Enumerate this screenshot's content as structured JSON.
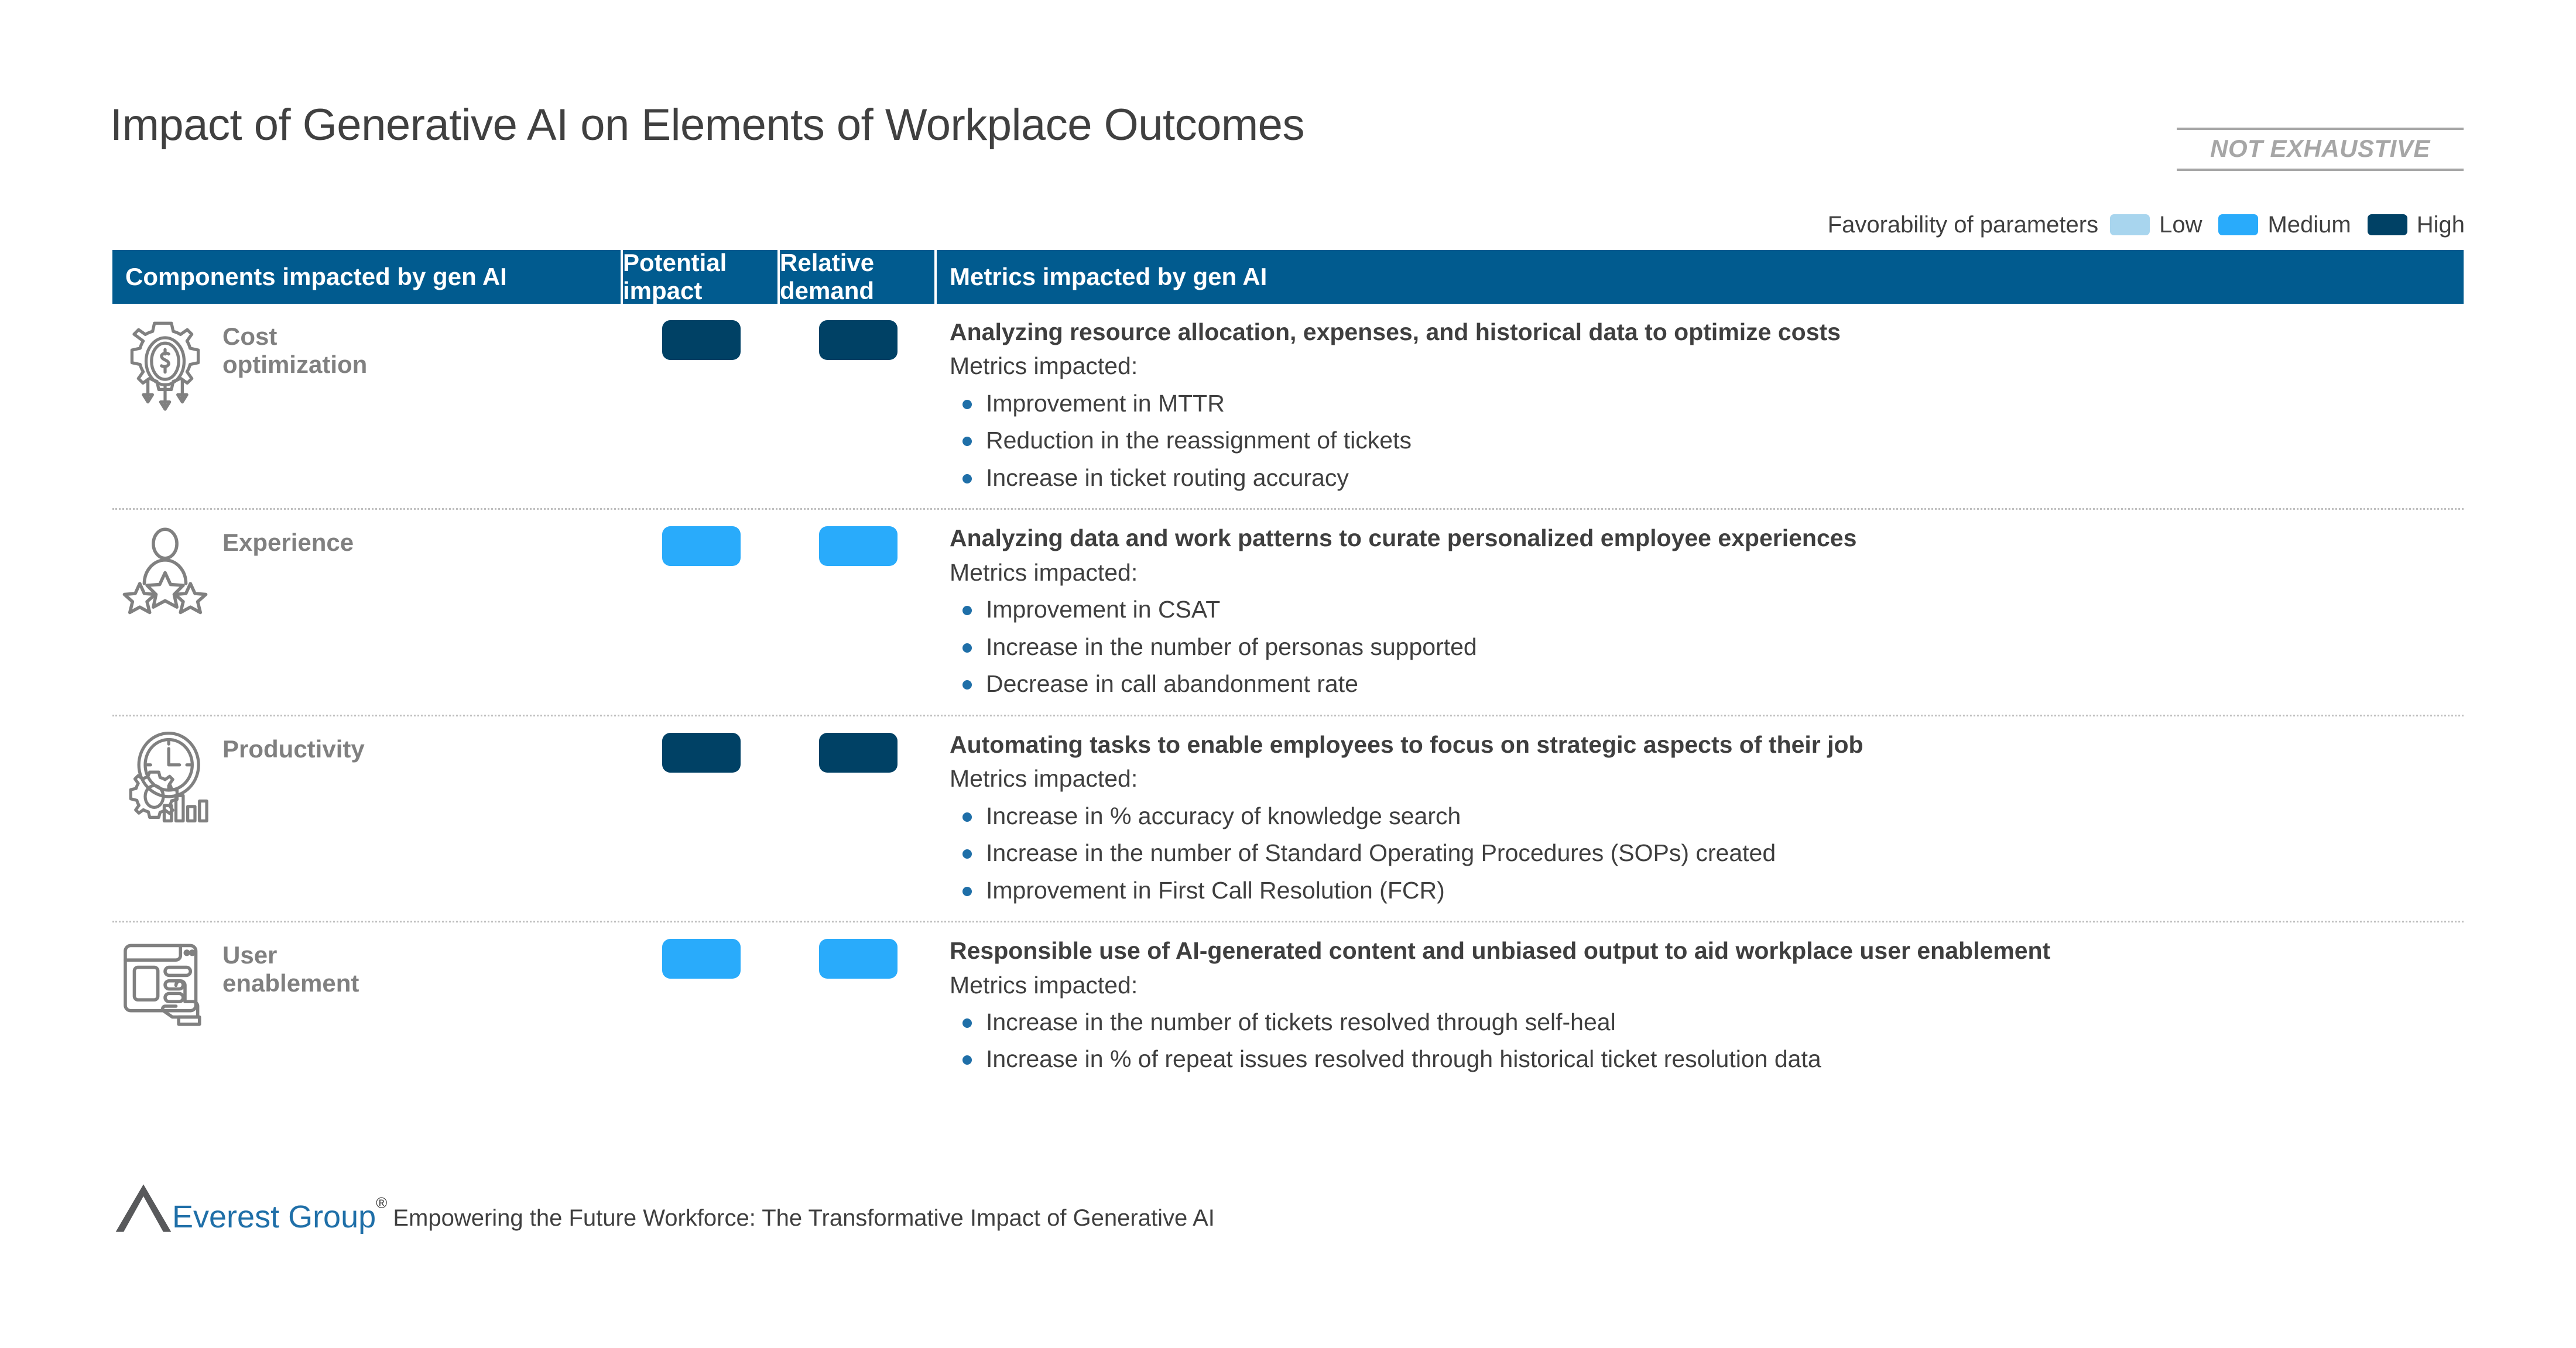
{
  "slide": {
    "title": "Impact of Generative AI on Elements of Workplace Outcomes",
    "stamp": "NOT EXHAUSTIVE"
  },
  "legend": {
    "title": "Favorability of parameters",
    "items": [
      {
        "label": "Low",
        "color": "#A8D5EE",
        "level": "low"
      },
      {
        "label": "Medium",
        "color": "#29ABFB",
        "level": "med"
      },
      {
        "label": "High",
        "color": "#004165",
        "level": "high"
      }
    ]
  },
  "table": {
    "header_color": "#015B8F",
    "columns": [
      "Components impacted by gen AI",
      "Potential impact",
      "Relative demand",
      "Metrics impacted by gen AI"
    ],
    "rows": [
      {
        "component": "Cost optimization",
        "icon": "cost-optimization-icon",
        "potential_impact": "High",
        "relative_demand": "High",
        "headline": "Analyzing resource allocation, expenses, and historical data to optimize costs",
        "metrics_label": "Metrics impacted:",
        "metrics": [
          "Improvement in MTTR",
          "Reduction in the reassignment of tickets",
          "Increase in ticket routing accuracy"
        ]
      },
      {
        "component": "Experience",
        "icon": "experience-icon",
        "potential_impact": "Medium",
        "relative_demand": "Medium",
        "headline": "Analyzing data and work patterns to curate personalized employee experiences",
        "metrics_label": "Metrics impacted:",
        "metrics": [
          "Improvement in CSAT",
          "Increase in the number of personas supported",
          "Decrease in call abandonment rate"
        ]
      },
      {
        "component": "Productivity",
        "icon": "productivity-icon",
        "potential_impact": "High",
        "relative_demand": "High",
        "headline": "Automating tasks to enable employees to focus on strategic aspects of their job",
        "metrics_label": "Metrics impacted:",
        "metrics": [
          "Increase in % accuracy of knowledge search",
          "Increase in the number of Standard Operating Procedures (SOPs) created",
          "Improvement in First Call Resolution (FCR)"
        ]
      },
      {
        "component": "User enablement",
        "icon": "user-enablement-icon",
        "potential_impact": "Medium",
        "relative_demand": "Medium",
        "headline": "Responsible use of AI-generated content and unbiased output to aid workplace user enablement",
        "metrics_label": "Metrics impacted:",
        "metrics": [
          "Increase in the number of tickets resolved through self-heal",
          "Increase in % of repeat issues resolved through historical ticket resolution data"
        ]
      }
    ]
  },
  "footer": {
    "brand": "Everest Group",
    "registered_mark": "®",
    "text": "Empowering the Future Workforce: The Transformative Impact of Generative AI"
  }
}
